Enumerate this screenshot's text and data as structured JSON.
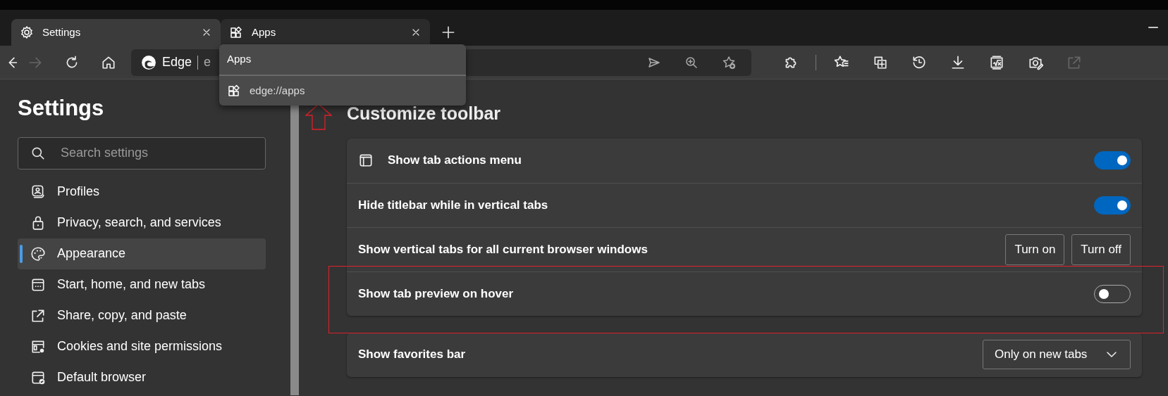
{
  "tabs": [
    {
      "label": "Settings",
      "selected": true
    },
    {
      "label": "Apps",
      "selected": false
    }
  ],
  "nav_buttons": [
    {
      "kind": "back",
      "disabled": false
    },
    {
      "kind": "forward",
      "disabled": true
    },
    {
      "kind": "refresh",
      "disabled": false
    },
    {
      "kind": "home",
      "disabled": false
    }
  ],
  "address_bar": {
    "site_label": "Edge",
    "text": "e"
  },
  "address_icons": [
    {
      "kind": "send"
    },
    {
      "kind": "zoom"
    },
    {
      "kind": "favorite-add"
    }
  ],
  "toolbar_buttons": [
    {
      "kind": "extensions",
      "disabled": false
    },
    {
      "kind": "separator"
    },
    {
      "kind": "favorites",
      "disabled": false
    },
    {
      "kind": "collections",
      "disabled": false
    },
    {
      "kind": "history",
      "disabled": false
    },
    {
      "kind": "downloads",
      "disabled": false
    },
    {
      "kind": "math",
      "disabled": false
    },
    {
      "kind": "capture",
      "disabled": false
    },
    {
      "kind": "share",
      "disabled": true
    }
  ],
  "hover_card": {
    "title": "Apps",
    "url": "edge://apps"
  },
  "sidebar": {
    "title": "Settings",
    "search": {
      "placeholder": "Search settings"
    },
    "items": [
      {
        "label": "Profiles",
        "selected": false
      },
      {
        "label": "Privacy, search, and services",
        "selected": false
      },
      {
        "label": "Appearance",
        "selected": true
      },
      {
        "label": "Start, home, and new tabs",
        "selected": false
      },
      {
        "label": "Share, copy, and paste",
        "selected": false
      },
      {
        "label": "Cookies and site permissions",
        "selected": false
      },
      {
        "label": "Default browser",
        "selected": false
      }
    ]
  },
  "section": {
    "title": "Customize toolbar",
    "rows": [
      {
        "kind": "toggle",
        "label": "Show tab actions menu",
        "has_icon": true,
        "on": true
      },
      {
        "kind": "toggle",
        "label": "Hide titlebar while in vertical tabs",
        "on": true
      },
      {
        "kind": "buttons",
        "label": "Show vertical tabs for all current browser windows",
        "buttons": [
          "Turn on",
          "Turn off"
        ]
      },
      {
        "kind": "toggle",
        "label": "Show tab preview on hover",
        "on": false
      }
    ]
  },
  "favorites_bar": {
    "label": "Show favorites bar",
    "value": "Only on new tabs"
  }
}
